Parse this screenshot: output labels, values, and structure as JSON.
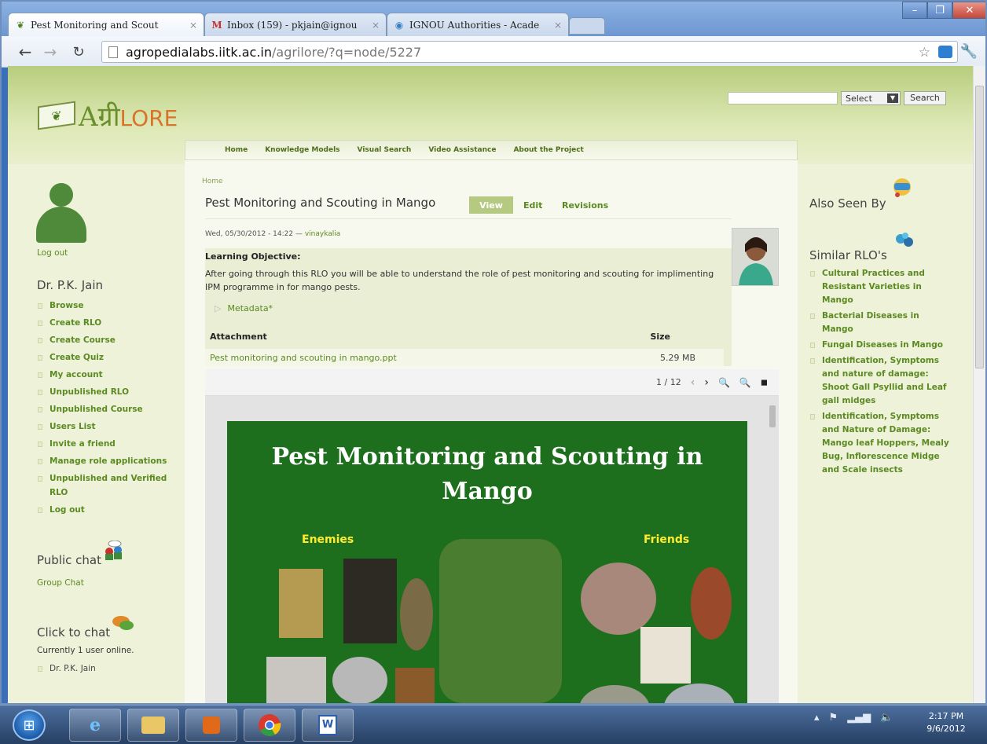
{
  "browser": {
    "tabs": [
      {
        "label": "Pest Monitoring and Scout",
        "icon": "agrilore-favicon",
        "active": true
      },
      {
        "label": "Inbox (159) - pkjain@ignou",
        "icon": "gmail-icon",
        "active": false
      },
      {
        "label": "IGNOU Authorities - Acade",
        "icon": "globe-icon",
        "active": false
      }
    ],
    "url_host": "agropedialabs.iitk.ac.in",
    "url_path": "/agrilore/?q=node/5227",
    "window_controls": [
      "–",
      "❐",
      "✕"
    ]
  },
  "site": {
    "logo_main": "Aग्री",
    "logo_suffix": "LORE",
    "search_placeholder": "",
    "select_label": "Select",
    "search_button": "Search",
    "nav": [
      "Home",
      "Knowledge Models",
      "Visual Search",
      "Video Assistance",
      "About the Project"
    ]
  },
  "left": {
    "logout_top": "Log out",
    "user_name": "Dr. P.K. Jain",
    "menu": [
      "Browse",
      "Create RLO",
      "Create Course",
      "Create Quiz",
      "My account",
      "Unpublished RLO",
      "Unpublished Course",
      "Users List",
      "Invite a friend",
      "Manage role applications",
      "Unpublished and Verified RLO",
      "Log out"
    ],
    "public_chat": "Public chat",
    "group_chat": "Group Chat",
    "click_chat": "Click to chat",
    "online": "Currently 1 user online.",
    "online_user": "Dr. P.K. Jain"
  },
  "main": {
    "breadcrumb": "Home",
    "title": "Pest Monitoring and Scouting in Mango",
    "tab_view": "View",
    "tab_edit": "Edit",
    "tab_revisions": "Revisions",
    "meta_date": "Wed, 05/30/2012 - 14:22 — ",
    "meta_user": "vinaykalia",
    "objective_label": "Learning Objective:",
    "objective_text": "After going through this RLO you will be able to understand the role of pest monitoring and scouting for implimenting  IPM  programme in for mango pests.",
    "metadata_link": "Metadata*",
    "attachment_head": "Attachment",
    "size_head": "Size",
    "attachment_file": "Pest monitoring and scouting in mango.ppt",
    "attachment_size": "5.29 MB",
    "viewer_page": "1 / 12",
    "slide_title": "Pest Monitoring and Scouting in Mango",
    "slide_enemies": "Enemies",
    "slide_friends": "Friends"
  },
  "right": {
    "also_seen": "Also Seen By",
    "similar": "Similar RLO's",
    "items": [
      "Cultural Practices and Resistant Varieties in Mango",
      "Bacterial Diseases in Mango",
      "Fungal Diseases in Mango",
      "Identification, Symptoms and nature of damage: Shoot Gall Psyllid and Leaf gall midges",
      "Identification, Symptoms and Nature of Damage: Mango leaf Hoppers, Mealy Bug, Inflorescence Midge and Scale insects"
    ]
  },
  "taskbar": {
    "time": "2:17 PM",
    "date": "9/6/2012",
    "apps": [
      "ie-icon",
      "explorer-icon",
      "media-player-icon",
      "chrome-icon",
      "word-icon"
    ]
  }
}
